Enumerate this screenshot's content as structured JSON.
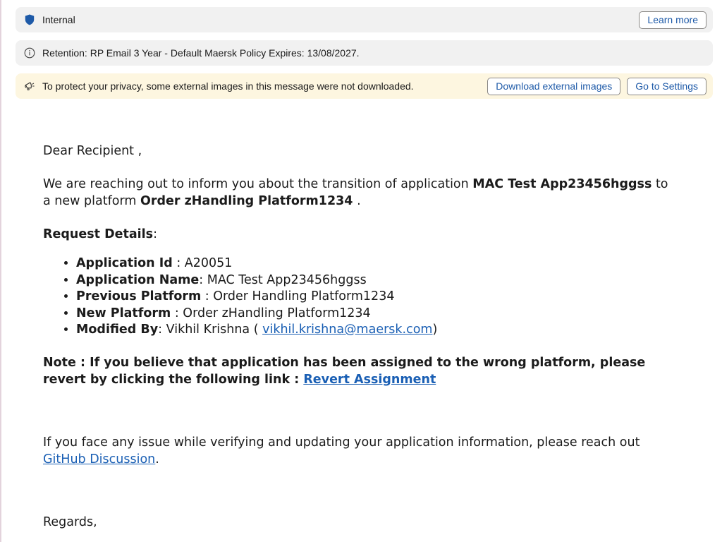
{
  "banners": {
    "sensitivity": {
      "label": "Internal",
      "icon": "shield-icon",
      "button": "Learn more"
    },
    "retention": {
      "text": "Retention: RP Email 3 Year - Default Maersk Policy Expires: 13/08/2027.",
      "icon": "info-icon"
    },
    "privacy": {
      "text": "To protect your privacy, some external images in this message were not downloaded.",
      "icon": "speaker-icon",
      "download_button": "Download external images",
      "settings_button": "Go to Settings"
    }
  },
  "email": {
    "greeting": "Dear Recipient ,",
    "intro_1": "We are reaching out to inform you about the transition of application ",
    "app_name_bold": "MAC Test App23456hggss",
    "intro_2": " to a new platform ",
    "platform_bold": "Order zHandling Platform1234",
    "intro_3": " .",
    "request_details_label": "Request Details",
    "request_details_colon": ":",
    "details": {
      "app_id_label": "Application Id",
      "app_id_value": " : A20051",
      "app_name_label": "Application Name",
      "app_name_value": ": MAC Test App23456hggss",
      "prev_platform_label": "Previous Platform",
      "prev_platform_value": " : Order Handling Platform1234",
      "new_platform_label": "New Platform",
      "new_platform_value": " : Order zHandling Platform1234",
      "modified_by_label": "Modified By",
      "modified_by_value": ": Vikhil Krishna ( ",
      "modified_by_email": "vikhil.krishna@maersk.com",
      "modified_by_close": ")"
    },
    "note_text": "Note : If you believe that application has been assigned to the wrong platform, please revert by clicking the following link : ",
    "note_link": "Revert Assignment",
    "issue_text": "If you face any issue while verifying and updating your application information, please reach out ",
    "issue_link": "GitHub Discussion",
    "issue_end": ".",
    "regards": "Regards,"
  },
  "colors": {
    "accent": "#1a5fb4",
    "banner_bg": "#f1f1f1",
    "privacy_bg": "#fdf6e0",
    "shield": "#1e5aa8"
  }
}
